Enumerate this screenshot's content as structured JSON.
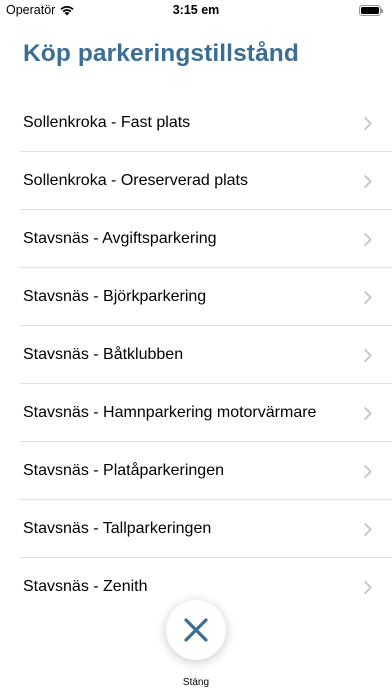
{
  "status_bar": {
    "carrier": "Operatör",
    "time": "3:15 em"
  },
  "page_title": "Köp parkeringstillstånd",
  "list": {
    "items": [
      {
        "label": "Sollenkroka - Fast plats"
      },
      {
        "label": "Sollenkroka - Oreserverad plats"
      },
      {
        "label": "Stavsnäs - Avgiftsparkering"
      },
      {
        "label": "Stavsnäs - Björkparkering"
      },
      {
        "label": "Stavsnäs - Båtklubben"
      },
      {
        "label": "Stavsnäs - Hamnparkering motorvärmare"
      },
      {
        "label": "Stavsnäs - Platåparkeringen"
      },
      {
        "label": "Stavsnäs - Tallparkeringen"
      },
      {
        "label": "Stavsnäs - Zenith"
      }
    ]
  },
  "close_button": {
    "label": "Stäng",
    "icon": "close-icon"
  },
  "colors": {
    "title": "#3b6e96",
    "close_icon": "#3b6e96",
    "chevron": "#c4c4c7",
    "divider": "#e2e2e2"
  }
}
